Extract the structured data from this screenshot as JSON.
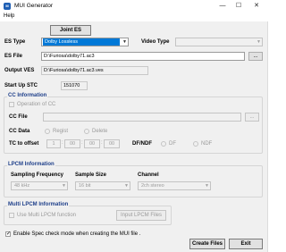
{
  "window": {
    "title": "MUI Generator",
    "app_icon": "app-logo-icon",
    "minimize": "—",
    "maximize": "☐",
    "close": "✕"
  },
  "menu": {
    "help": "Help"
  },
  "joint_es_label": "Joint ES",
  "es": {
    "type_label": "ES Type",
    "type_value": "Dolby Lossless",
    "video_type_label": "Video Type",
    "video_type_value": "",
    "file_label": "ES File",
    "file_value": "D:\\Furiosa\\dolby71.ac3",
    "browse_label": "..."
  },
  "output_ves": {
    "label": "Output VES",
    "value": "D:\\Furiosa\\dolby71.ac3.ves"
  },
  "start_stc": {
    "label": "Start Up STC",
    "value": "151070"
  },
  "cc": {
    "title": "CC Information",
    "operation_label": "Operation of CC",
    "file_label": "CC File",
    "file_value": "",
    "browse_label": "...",
    "data_label": "CC Data",
    "regist_label": "Regist",
    "delete_label": "Delete",
    "tc_label": "TC to offset",
    "tc_values": [
      "1",
      "00",
      "00",
      "00"
    ],
    "tc_separators": [
      ":",
      ":",
      ":"
    ],
    "dfndf_label": "DF/NDF",
    "df_label": "DF",
    "ndf_label": "NDF"
  },
  "lpcm": {
    "title": "LPCM Information",
    "freq_label": "Sampling Frequency",
    "freq_value": "48 kHz",
    "size_label": "Sample Size",
    "size_value": "16 bit",
    "channel_label": "Channel",
    "channel_value": "2ch stereo"
  },
  "multi_lpcm": {
    "title": "Multi LPCM Information",
    "use_label": "Use Multi LPCM function",
    "input_files_label": "Input LPCM Files"
  },
  "spec_check": {
    "label": "Enable Spec check mode when creating the MUI file .",
    "checked": true
  },
  "create_label": "Create Files",
  "exit_label": "Exit",
  "colors": {
    "accent": "#0078d7",
    "group_title": "#1e3f8a"
  }
}
